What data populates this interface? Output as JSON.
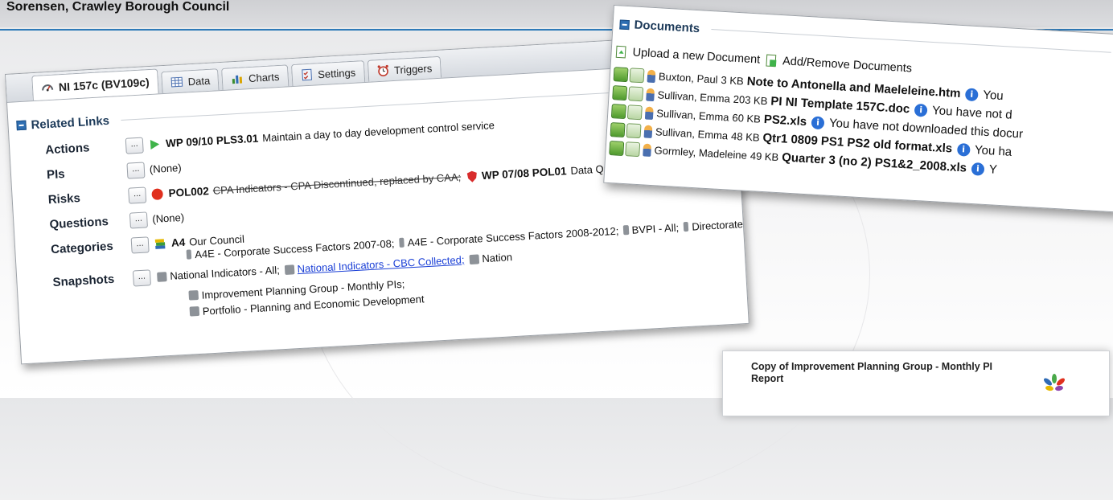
{
  "header": {
    "title": "Sorensen, Crawley Borough Council"
  },
  "tabs": [
    {
      "label": "NI 157c (BV109c)",
      "icon": "gauge-icon"
    },
    {
      "label": "Data",
      "icon": "table-icon"
    },
    {
      "label": "Charts",
      "icon": "bar-chart-icon"
    },
    {
      "label": "Settings",
      "icon": "checklist-icon"
    },
    {
      "label": "Triggers",
      "icon": "alarm-clock-icon"
    }
  ],
  "related_links": {
    "title": "Related Links",
    "more_label": "...",
    "actions": {
      "label": "Actions",
      "code": "WP 09/10 PLS3.01",
      "text": "Maintain a day to day development control service"
    },
    "pis": {
      "label": "PIs",
      "text": "(None)"
    },
    "risks": {
      "label": "Risks",
      "item1_code": "POL002",
      "item1_text": "CPA Indicators - CPA Discontinued, replaced by CAA;",
      "item2_code": "WP 07/08 POL01",
      "item2_text": "Data Quality - High Risk PI"
    },
    "questions": {
      "label": "Questions",
      "text": "(None)"
    },
    "categories": {
      "label": "Categories",
      "code": "A4",
      "text": "Our Council",
      "extra": "A4E - Corporate Success Factors 2007-08;",
      "extra2": "A4E - Corporate Success Factors 2008-2012;",
      "extra3": "BVPI - All;",
      "extra4": "Directorate"
    },
    "snapshots": {
      "label": "Snapshots",
      "s1": "National Indicators - All;",
      "s2": "National Indicators - CBC Collected;",
      "s3": "Nation",
      "s4": "Improvement Planning Group - Monthly PIs;",
      "s5": "Portfolio - Planning and Economic Development"
    }
  },
  "documents": {
    "title": "Documents",
    "upload_label": "Upload a new Document",
    "addremove_label": "Add/Remove Documents",
    "items": [
      {
        "owner": "Buxton, Paul",
        "size": "3 KB",
        "file": "Note to Antonella and Maeleleine.htm",
        "status": "You"
      },
      {
        "owner": "Sullivan, Emma",
        "size": "203 KB",
        "file": "PI NI Template 157C.doc",
        "status": "You have not d"
      },
      {
        "owner": "Sullivan, Emma",
        "size": "60 KB",
        "file": "PS2.xls",
        "status": "You have not downloaded this docur"
      },
      {
        "owner": "Sullivan, Emma",
        "size": "48 KB",
        "file": "Qtr1 0809 PS1 PS2 old format.xls",
        "status": "You ha"
      },
      {
        "owner": "Gormley, Madeleine",
        "size": "49 KB",
        "file": "Quarter 3 (no 2) PS1&2_2008.xls",
        "status": "Y"
      }
    ]
  },
  "report": {
    "title": "Copy of Improvement Planning Group - Monthly PI Report"
  }
}
